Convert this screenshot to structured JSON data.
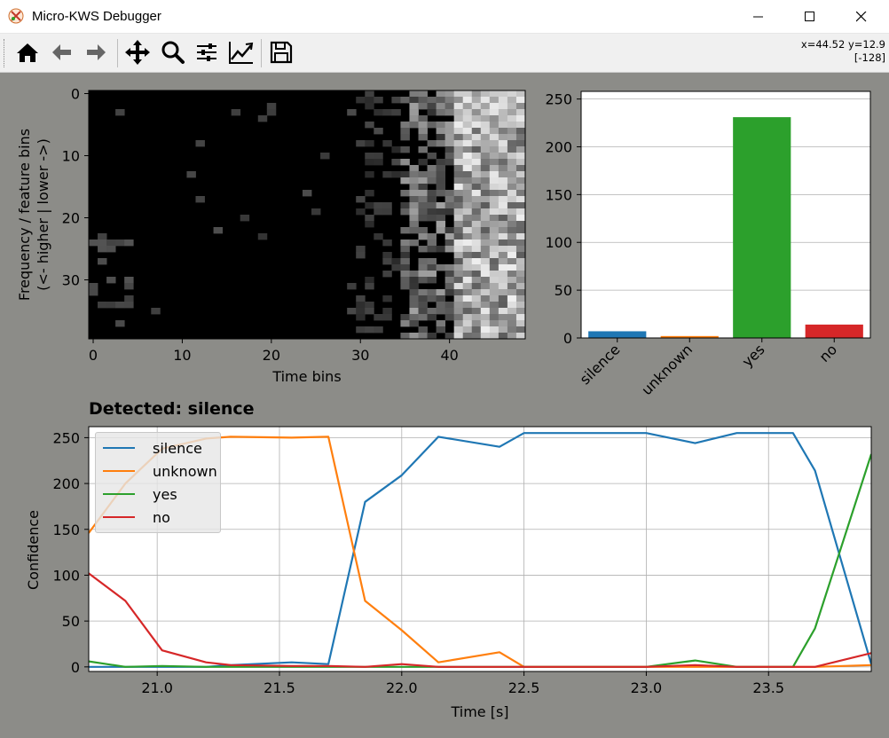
{
  "window": {
    "title": "Micro-KWS Debugger"
  },
  "toolbar": {
    "buttons": [
      {
        "name": "home",
        "icon": "home-icon"
      },
      {
        "name": "back",
        "icon": "back-arrow-icon"
      },
      {
        "name": "forward",
        "icon": "forward-arrow-icon"
      },
      {
        "name": "pan",
        "icon": "move-icon"
      },
      {
        "name": "zoom",
        "icon": "zoom-icon"
      },
      {
        "name": "subplots",
        "icon": "sliders-icon"
      },
      {
        "name": "customize",
        "icon": "line-chart-icon"
      },
      {
        "name": "save",
        "icon": "save-icon"
      }
    ],
    "coords_line1": "x=44.52 y=12.9",
    "coords_line2": "[-128]"
  },
  "colors": {
    "silence": "#1f77b4",
    "unknown": "#ff7f0e",
    "yes": "#2ca02c",
    "no": "#d62728",
    "figure_bg": "#8c8c88"
  },
  "chart_data": [
    {
      "type": "heatmap",
      "xlabel": "Time bins",
      "ylabel_line1": "Frequency / feature bins",
      "ylabel_line2": "(<- higher | lower ->)",
      "xlim": [
        -0.5,
        48.5
      ],
      "ylim": [
        39.5,
        -0.5
      ],
      "n_time_bins": 49,
      "n_feature_bins": 40,
      "xticks": [
        0,
        10,
        20,
        30,
        40
      ],
      "yticks": [
        0,
        10,
        20,
        30
      ],
      "colormap": "gray"
    },
    {
      "type": "bar",
      "categories": [
        "silence",
        "unknown",
        "yes",
        "no"
      ],
      "values": [
        7,
        2,
        231,
        14
      ],
      "ylim": [
        0,
        258
      ],
      "yticks": [
        0,
        50,
        100,
        150,
        200,
        250
      ],
      "grid": "y"
    },
    {
      "type": "line",
      "title": "Detected: silence",
      "xlabel": "Time [s]",
      "ylabel": "Confidence",
      "xlim": [
        20.72,
        23.92
      ],
      "ylim": [
        -5,
        262
      ],
      "xticks": [
        21.0,
        21.5,
        22.0,
        22.5,
        23.0,
        23.5
      ],
      "xtick_labels": [
        "21.0",
        "21.5",
        "22.0",
        "22.5",
        "23.0",
        "23.5"
      ],
      "yticks": [
        0,
        50,
        100,
        150,
        200,
        250
      ],
      "grid": true,
      "legend": "upper-left",
      "x": [
        20.72,
        20.87,
        21.02,
        21.2,
        21.3,
        21.55,
        21.7,
        21.85,
        22.0,
        22.15,
        22.4,
        22.5,
        22.85,
        23.0,
        23.2,
        23.37,
        23.6,
        23.69,
        23.92
      ],
      "series": [
        {
          "name": "silence",
          "values": [
            0,
            0,
            0,
            0,
            2,
            5,
            3,
            180,
            209,
            251,
            240,
            255,
            255,
            255,
            244,
            255,
            255,
            214,
            3
          ]
        },
        {
          "name": "unknown",
          "values": [
            146,
            200,
            238,
            249,
            251,
            250,
            251,
            72,
            40,
            5,
            16,
            0,
            0,
            0,
            0,
            0,
            0,
            0,
            2
          ]
        },
        {
          "name": "yes",
          "values": [
            6,
            0,
            1,
            0,
            0,
            0,
            0,
            0,
            0,
            0,
            0,
            0,
            0,
            0,
            7,
            0,
            0,
            42,
            232
          ]
        },
        {
          "name": "no",
          "values": [
            102,
            72,
            18,
            5,
            2,
            1,
            1,
            0,
            3,
            0,
            0,
            0,
            0,
            0,
            2,
            0,
            0,
            0,
            15
          ]
        }
      ]
    }
  ]
}
